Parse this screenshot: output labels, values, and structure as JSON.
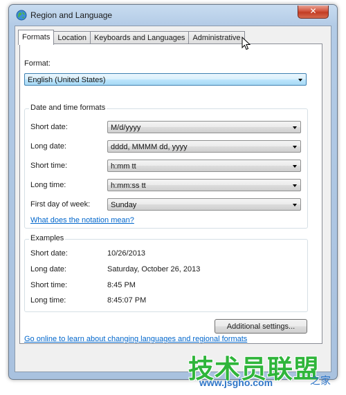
{
  "window": {
    "title": "Region and Language",
    "close_glyph": "✕"
  },
  "tabs": [
    {
      "label": "Formats",
      "active": true
    },
    {
      "label": "Location",
      "active": false
    },
    {
      "label": "Keyboards and Languages",
      "active": false
    },
    {
      "label": "Administrative",
      "active": false
    }
  ],
  "format": {
    "label": "Format:",
    "value": "English (United States)"
  },
  "date_time_formats": {
    "title": "Date and time formats",
    "rows": [
      {
        "label": "Short date:",
        "value": "M/d/yyyy"
      },
      {
        "label": "Long date:",
        "value": "dddd, MMMM dd, yyyy"
      },
      {
        "label": "Short time:",
        "value": "h:mm tt"
      },
      {
        "label": "Long time:",
        "value": "h:mm:ss tt"
      },
      {
        "label": "First day of week:",
        "value": "Sunday"
      }
    ],
    "notation_link": "What does the notation mean?"
  },
  "examples": {
    "title": "Examples",
    "rows": [
      {
        "label": "Short date:",
        "value": "10/26/2013"
      },
      {
        "label": "Long date:",
        "value": "Saturday, October 26, 2013"
      },
      {
        "label": "Short time:",
        "value": "8:45 PM"
      },
      {
        "label": "Long time:",
        "value": "8:45:07 PM"
      }
    ]
  },
  "additional_settings_label": "Additional settings...",
  "online_link": "Go online to learn about changing languages and regional formats",
  "watermark": {
    "brand": "技术员联盟",
    "url": "www.jsgho.com",
    "cn": "之家"
  },
  "colors": {
    "title_bar": "#b3cbe6",
    "close_button": "#c23c24",
    "link": "#0066cc",
    "watermark_green": "#2fb53a",
    "watermark_blue": "#2f76c8"
  }
}
